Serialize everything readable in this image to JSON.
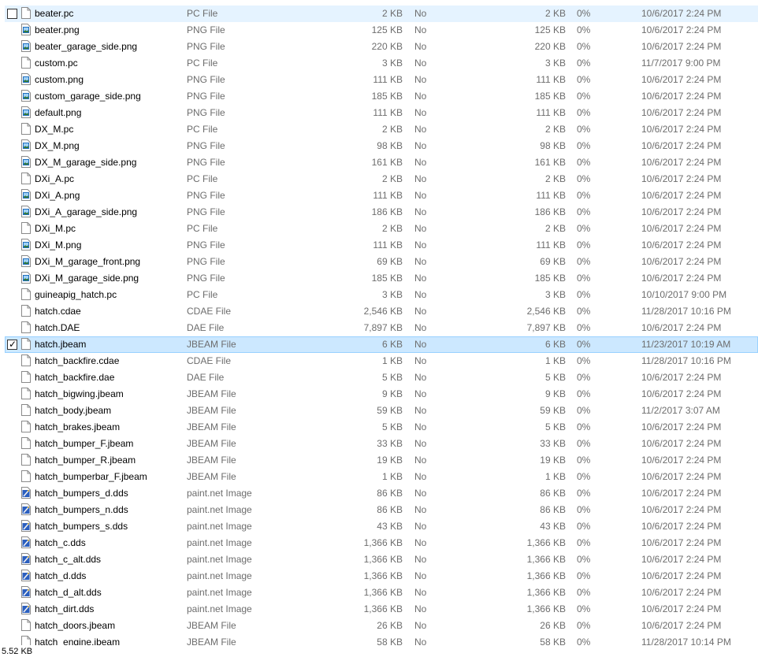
{
  "files": [
    {
      "name": "beater.pc",
      "type": "PC File",
      "size": "2 KB",
      "encrypted": "No",
      "compressed": "2 KB",
      "ratio": "0%",
      "modified": "10/6/2017 2:24 PM",
      "icon": "blank-file-icon",
      "checked": false,
      "state": "hover"
    },
    {
      "name": "beater.png",
      "type": "PNG File",
      "size": "125 KB",
      "encrypted": "No",
      "compressed": "125 KB",
      "ratio": "0%",
      "modified": "10/6/2017 2:24 PM",
      "icon": "image-file-icon"
    },
    {
      "name": "beater_garage_side.png",
      "type": "PNG File",
      "size": "220 KB",
      "encrypted": "No",
      "compressed": "220 KB",
      "ratio": "0%",
      "modified": "10/6/2017 2:24 PM",
      "icon": "image-file-icon"
    },
    {
      "name": "custom.pc",
      "type": "PC File",
      "size": "3 KB",
      "encrypted": "No",
      "compressed": "3 KB",
      "ratio": "0%",
      "modified": "11/7/2017 9:00 PM",
      "icon": "blank-file-icon"
    },
    {
      "name": "custom.png",
      "type": "PNG File",
      "size": "111 KB",
      "encrypted": "No",
      "compressed": "111 KB",
      "ratio": "0%",
      "modified": "10/6/2017 2:24 PM",
      "icon": "image-file-icon"
    },
    {
      "name": "custom_garage_side.png",
      "type": "PNG File",
      "size": "185 KB",
      "encrypted": "No",
      "compressed": "185 KB",
      "ratio": "0%",
      "modified": "10/6/2017 2:24 PM",
      "icon": "image-file-icon"
    },
    {
      "name": "default.png",
      "type": "PNG File",
      "size": "111 KB",
      "encrypted": "No",
      "compressed": "111 KB",
      "ratio": "0%",
      "modified": "10/6/2017 2:24 PM",
      "icon": "image-file-icon"
    },
    {
      "name": "DX_M.pc",
      "type": "PC File",
      "size": "2 KB",
      "encrypted": "No",
      "compressed": "2 KB",
      "ratio": "0%",
      "modified": "10/6/2017 2:24 PM",
      "icon": "blank-file-icon"
    },
    {
      "name": "DX_M.png",
      "type": "PNG File",
      "size": "98 KB",
      "encrypted": "No",
      "compressed": "98 KB",
      "ratio": "0%",
      "modified": "10/6/2017 2:24 PM",
      "icon": "image-file-icon"
    },
    {
      "name": "DX_M_garage_side.png",
      "type": "PNG File",
      "size": "161 KB",
      "encrypted": "No",
      "compressed": "161 KB",
      "ratio": "0%",
      "modified": "10/6/2017 2:24 PM",
      "icon": "image-file-icon"
    },
    {
      "name": "DXi_A.pc",
      "type": "PC File",
      "size": "2 KB",
      "encrypted": "No",
      "compressed": "2 KB",
      "ratio": "0%",
      "modified": "10/6/2017 2:24 PM",
      "icon": "blank-file-icon"
    },
    {
      "name": "DXi_A.png",
      "type": "PNG File",
      "size": "111 KB",
      "encrypted": "No",
      "compressed": "111 KB",
      "ratio": "0%",
      "modified": "10/6/2017 2:24 PM",
      "icon": "image-file-icon"
    },
    {
      "name": "DXi_A_garage_side.png",
      "type": "PNG File",
      "size": "186 KB",
      "encrypted": "No",
      "compressed": "186 KB",
      "ratio": "0%",
      "modified": "10/6/2017 2:24 PM",
      "icon": "image-file-icon"
    },
    {
      "name": "DXi_M.pc",
      "type": "PC File",
      "size": "2 KB",
      "encrypted": "No",
      "compressed": "2 KB",
      "ratio": "0%",
      "modified": "10/6/2017 2:24 PM",
      "icon": "blank-file-icon"
    },
    {
      "name": "DXi_M.png",
      "type": "PNG File",
      "size": "111 KB",
      "encrypted": "No",
      "compressed": "111 KB",
      "ratio": "0%",
      "modified": "10/6/2017 2:24 PM",
      "icon": "image-file-icon"
    },
    {
      "name": "DXi_M_garage_front.png",
      "type": "PNG File",
      "size": "69 KB",
      "encrypted": "No",
      "compressed": "69 KB",
      "ratio": "0%",
      "modified": "10/6/2017 2:24 PM",
      "icon": "image-file-icon"
    },
    {
      "name": "DXi_M_garage_side.png",
      "type": "PNG File",
      "size": "185 KB",
      "encrypted": "No",
      "compressed": "185 KB",
      "ratio": "0%",
      "modified": "10/6/2017 2:24 PM",
      "icon": "image-file-icon"
    },
    {
      "name": "guineapig_hatch.pc",
      "type": "PC File",
      "size": "3 KB",
      "encrypted": "No",
      "compressed": "3 KB",
      "ratio": "0%",
      "modified": "10/10/2017 9:00 PM",
      "icon": "blank-file-icon"
    },
    {
      "name": "hatch.cdae",
      "type": "CDAE File",
      "size": "2,546 KB",
      "encrypted": "No",
      "compressed": "2,546 KB",
      "ratio": "0%",
      "modified": "11/28/2017 10:16 PM",
      "icon": "blank-file-icon"
    },
    {
      "name": "hatch.DAE",
      "type": "DAE File",
      "size": "7,897 KB",
      "encrypted": "No",
      "compressed": "7,897 KB",
      "ratio": "0%",
      "modified": "10/6/2017 2:24 PM",
      "icon": "blank-file-icon"
    },
    {
      "name": "hatch.jbeam",
      "type": "JBEAM File",
      "size": "6 KB",
      "encrypted": "No",
      "compressed": "6 KB",
      "ratio": "0%",
      "modified": "11/23/2017 10:19 AM",
      "icon": "blank-file-icon",
      "checked": true,
      "state": "selected"
    },
    {
      "name": "hatch_backfire.cdae",
      "type": "CDAE File",
      "size": "1 KB",
      "encrypted": "No",
      "compressed": "1 KB",
      "ratio": "0%",
      "modified": "11/28/2017 10:16 PM",
      "icon": "blank-file-icon"
    },
    {
      "name": "hatch_backfire.dae",
      "type": "DAE File",
      "size": "5 KB",
      "encrypted": "No",
      "compressed": "5 KB",
      "ratio": "0%",
      "modified": "10/6/2017 2:24 PM",
      "icon": "blank-file-icon"
    },
    {
      "name": "hatch_bigwing.jbeam",
      "type": "JBEAM File",
      "size": "9 KB",
      "encrypted": "No",
      "compressed": "9 KB",
      "ratio": "0%",
      "modified": "10/6/2017 2:24 PM",
      "icon": "blank-file-icon"
    },
    {
      "name": "hatch_body.jbeam",
      "type": "JBEAM File",
      "size": "59 KB",
      "encrypted": "No",
      "compressed": "59 KB",
      "ratio": "0%",
      "modified": "11/2/2017 3:07 AM",
      "icon": "blank-file-icon"
    },
    {
      "name": "hatch_brakes.jbeam",
      "type": "JBEAM File",
      "size": "5 KB",
      "encrypted": "No",
      "compressed": "5 KB",
      "ratio": "0%",
      "modified": "10/6/2017 2:24 PM",
      "icon": "blank-file-icon"
    },
    {
      "name": "hatch_bumper_F.jbeam",
      "type": "JBEAM File",
      "size": "33 KB",
      "encrypted": "No",
      "compressed": "33 KB",
      "ratio": "0%",
      "modified": "10/6/2017 2:24 PM",
      "icon": "blank-file-icon"
    },
    {
      "name": "hatch_bumper_R.jbeam",
      "type": "JBEAM File",
      "size": "19 KB",
      "encrypted": "No",
      "compressed": "19 KB",
      "ratio": "0%",
      "modified": "10/6/2017 2:24 PM",
      "icon": "blank-file-icon"
    },
    {
      "name": "hatch_bumperbar_F.jbeam",
      "type": "JBEAM File",
      "size": "1 KB",
      "encrypted": "No",
      "compressed": "1 KB",
      "ratio": "0%",
      "modified": "10/6/2017 2:24 PM",
      "icon": "blank-file-icon"
    },
    {
      "name": "hatch_bumpers_d.dds",
      "type": "paint.net Image",
      "size": "86 KB",
      "encrypted": "No",
      "compressed": "86 KB",
      "ratio": "0%",
      "modified": "10/6/2017 2:24 PM",
      "icon": "paint-image-icon"
    },
    {
      "name": "hatch_bumpers_n.dds",
      "type": "paint.net Image",
      "size": "86 KB",
      "encrypted": "No",
      "compressed": "86 KB",
      "ratio": "0%",
      "modified": "10/6/2017 2:24 PM",
      "icon": "paint-image-icon"
    },
    {
      "name": "hatch_bumpers_s.dds",
      "type": "paint.net Image",
      "size": "43 KB",
      "encrypted": "No",
      "compressed": "43 KB",
      "ratio": "0%",
      "modified": "10/6/2017 2:24 PM",
      "icon": "paint-image-icon"
    },
    {
      "name": "hatch_c.dds",
      "type": "paint.net Image",
      "size": "1,366 KB",
      "encrypted": "No",
      "compressed": "1,366 KB",
      "ratio": "0%",
      "modified": "10/6/2017 2:24 PM",
      "icon": "paint-image-icon"
    },
    {
      "name": "hatch_c_alt.dds",
      "type": "paint.net Image",
      "size": "1,366 KB",
      "encrypted": "No",
      "compressed": "1,366 KB",
      "ratio": "0%",
      "modified": "10/6/2017 2:24 PM",
      "icon": "paint-image-icon"
    },
    {
      "name": "hatch_d.dds",
      "type": "paint.net Image",
      "size": "1,366 KB",
      "encrypted": "No",
      "compressed": "1,366 KB",
      "ratio": "0%",
      "modified": "10/6/2017 2:24 PM",
      "icon": "paint-image-icon"
    },
    {
      "name": "hatch_d_alt.dds",
      "type": "paint.net Image",
      "size": "1,366 KB",
      "encrypted": "No",
      "compressed": "1,366 KB",
      "ratio": "0%",
      "modified": "10/6/2017 2:24 PM",
      "icon": "paint-image-icon"
    },
    {
      "name": "hatch_dirt.dds",
      "type": "paint.net Image",
      "size": "1,366 KB",
      "encrypted": "No",
      "compressed": "1,366 KB",
      "ratio": "0%",
      "modified": "10/6/2017 2:24 PM",
      "icon": "paint-image-icon"
    },
    {
      "name": "hatch_doors.jbeam",
      "type": "JBEAM File",
      "size": "26 KB",
      "encrypted": "No",
      "compressed": "26 KB",
      "ratio": "0%",
      "modified": "10/6/2017 2:24 PM",
      "icon": "blank-file-icon"
    },
    {
      "name": "hatch_engine.jbeam",
      "type": "JBEAM File",
      "size": "58 KB",
      "encrypted": "No",
      "compressed": "58 KB",
      "ratio": "0%",
      "modified": "11/28/2017 10:14 PM",
      "icon": "blank-file-icon"
    }
  ],
  "status": {
    "selected_size": "5.52 KB"
  }
}
